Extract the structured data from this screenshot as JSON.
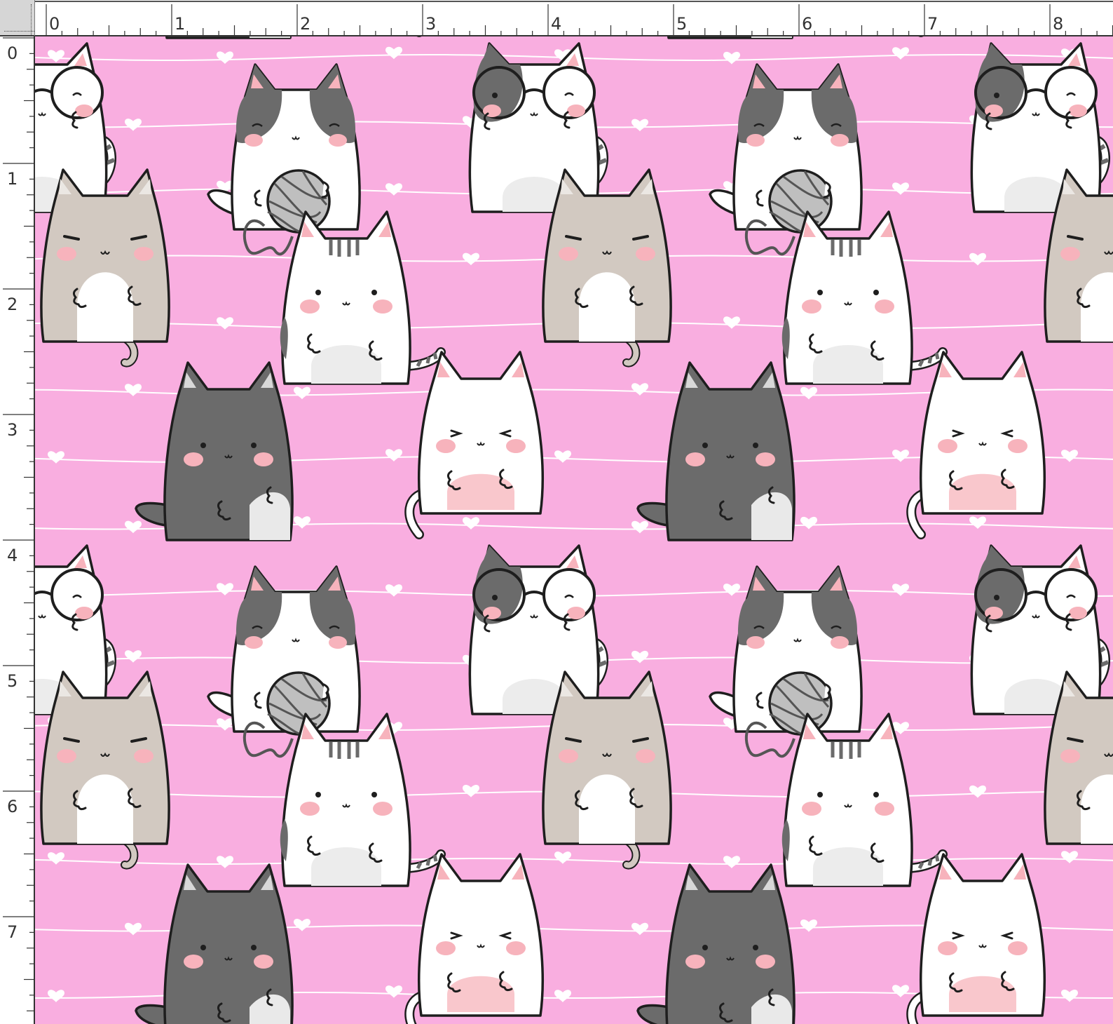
{
  "rulers": {
    "top_labels": [
      "0",
      "1",
      "2",
      "3",
      "4",
      "5",
      "6",
      "7",
      "8"
    ],
    "left_labels": [
      "0",
      "1",
      "2",
      "3",
      "4",
      "5",
      "6",
      "7"
    ]
  },
  "colors": {
    "background": "#f9aee0",
    "line": "#ffffff",
    "outline": "#1e1e1e",
    "blush": "#f7b3bc",
    "gray_dark": "#6b6b6b",
    "gray_beige": "#d2c9c1",
    "white": "#ffffff",
    "yarn": "#bfbfbf"
  },
  "pattern": {
    "name": "kawaii-cats-pattern",
    "motifs": [
      "spotted-cat-with-yarn",
      "cat-with-glasses",
      "beige-cat",
      "tabby-white-cat",
      "dark-gray-cat",
      "white-winking-cat",
      "heart-icon"
    ]
  }
}
